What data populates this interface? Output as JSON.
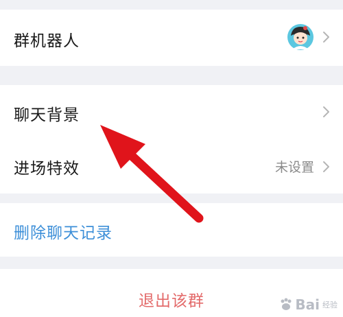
{
  "settings": {
    "group_robot_label": "群机器人",
    "chat_background_label": "聊天背景",
    "entry_effect_label": "进场特效",
    "entry_effect_value": "未设置",
    "delete_history_label": "删除聊天记录",
    "exit_group_label": "退出该群"
  },
  "colors": {
    "background": "#f0f1f5",
    "row_background": "#ffffff",
    "link_blue": "#3d8fd8",
    "exit_red": "#e36b6b",
    "annotation_arrow": "#e0141b"
  },
  "icons": {
    "avatar": "robot-avatar-icon",
    "chevron": "chevron-right-icon",
    "arrow": "red-annotation-arrow"
  },
  "watermark": {
    "brand": "Bai",
    "sub": "经验"
  }
}
